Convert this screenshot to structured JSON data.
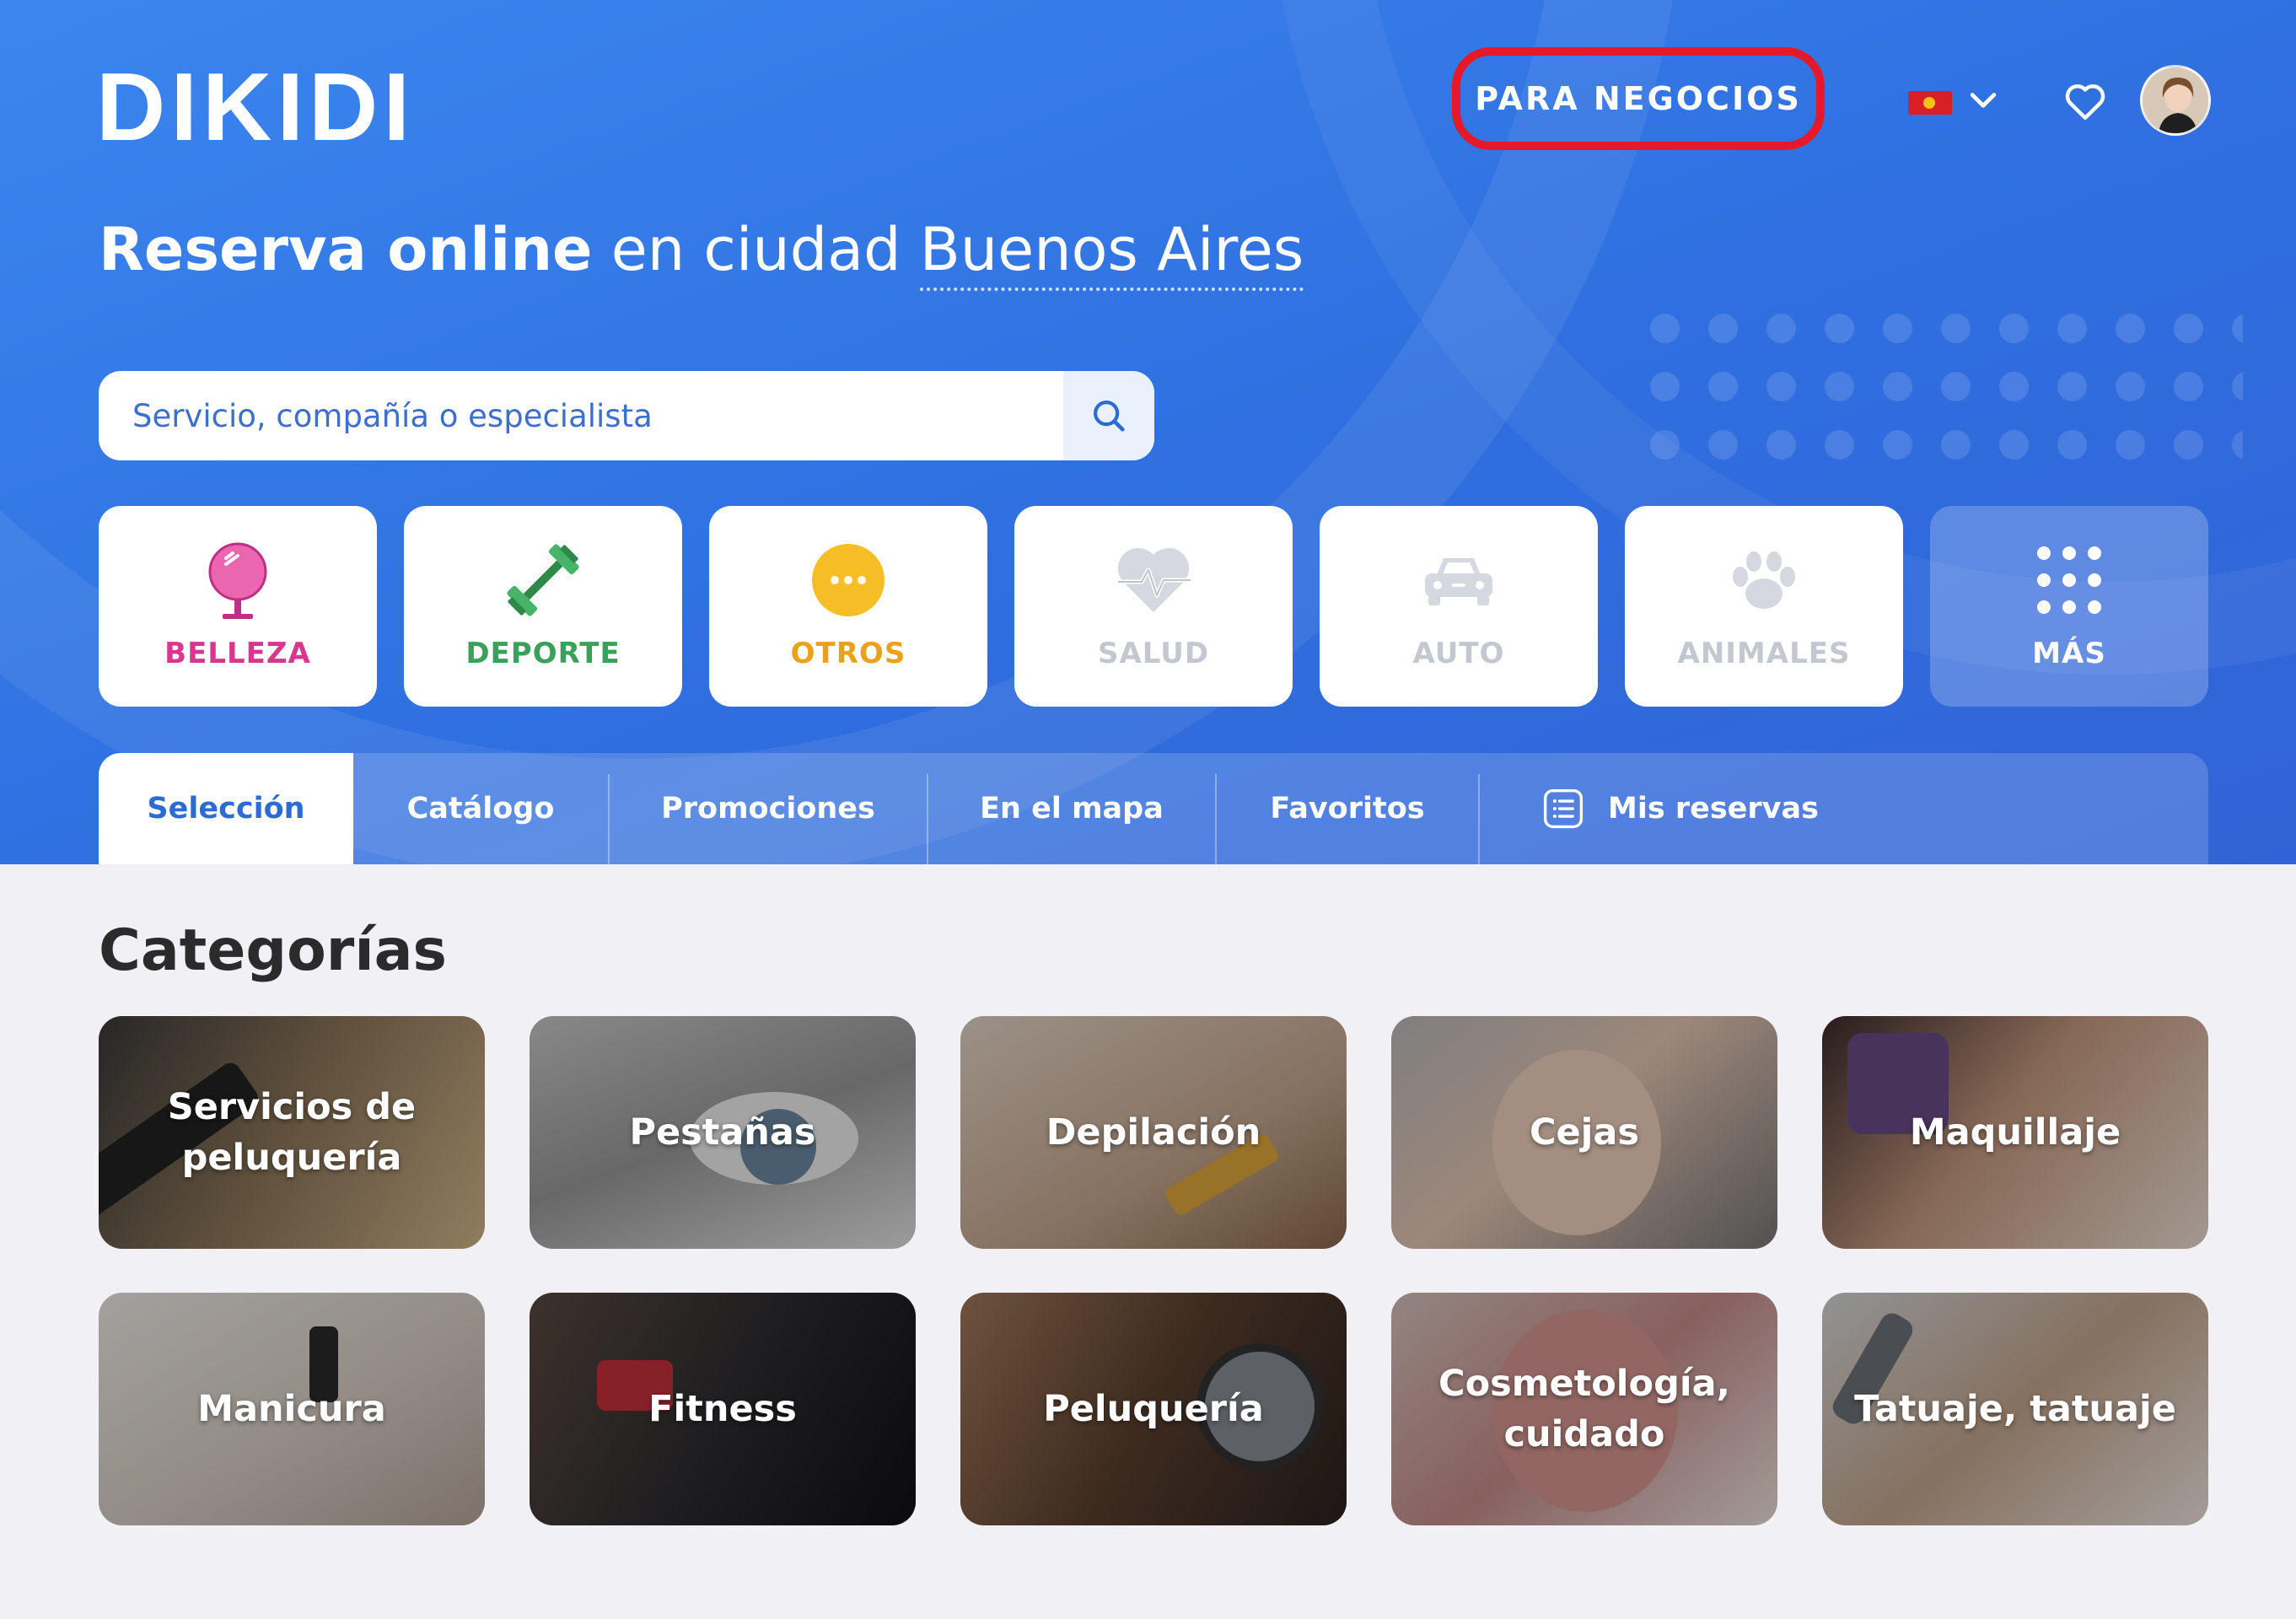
{
  "header": {
    "logo": "DIKIDI",
    "business_button": "PARA NEGOCIOS",
    "language_flag_icon": "portugal-flag-icon",
    "chevron_icon": "chevron-down-icon",
    "favorites_icon": "heart-icon",
    "avatar_icon": "user-avatar"
  },
  "hero": {
    "headline_strong": "Reserva online",
    "headline_middle": " en ciudad ",
    "headline_city": "Buenos Aires"
  },
  "search": {
    "placeholder": "Servicio, compañía o especialista",
    "icon": "search-icon"
  },
  "tiles": [
    {
      "label": "BELLEZA",
      "icon": "mirror-icon",
      "color": "#d9378f"
    },
    {
      "label": "DEPORTE",
      "icon": "dumbbell-icon",
      "color": "#3aa05a"
    },
    {
      "label": "OTROS",
      "icon": "dots-circle-icon",
      "color": "#eaa21a"
    },
    {
      "label": "SALUD",
      "icon": "heart-pulse-icon",
      "color": "#c3c7cf"
    },
    {
      "label": "AUTO",
      "icon": "car-icon",
      "color": "#c3c7cf"
    },
    {
      "label": "ANIMALES",
      "icon": "paw-icon",
      "color": "#c3c7cf"
    },
    {
      "label": "MÁS",
      "icon": "grid-dots-icon",
      "color": "#ffffff"
    }
  ],
  "tabs": [
    {
      "label": "Selección",
      "active": true
    },
    {
      "label": "Catálogo"
    },
    {
      "label": "Promociones"
    },
    {
      "label": "En el mapa"
    },
    {
      "label": "Favoritos"
    },
    {
      "label": "Mis reservas",
      "icon": "list-icon"
    }
  ],
  "categories": {
    "title": "Categorías",
    "items": [
      {
        "label": "Servicios de peluquería"
      },
      {
        "label": "Pestañas"
      },
      {
        "label": "Depilación"
      },
      {
        "label": "Cejas"
      },
      {
        "label": "Maquillaje"
      },
      {
        "label": "Manicura"
      },
      {
        "label": "Fitness"
      },
      {
        "label": "Peluquería"
      },
      {
        "label": "Cosmetología, cuidado"
      },
      {
        "label": "Tatuaje, tatuaje"
      }
    ]
  },
  "colors": {
    "brand_blue": "#2f6fdf",
    "highlight_red": "#e6192b",
    "page_background": "#f0f0f5"
  }
}
